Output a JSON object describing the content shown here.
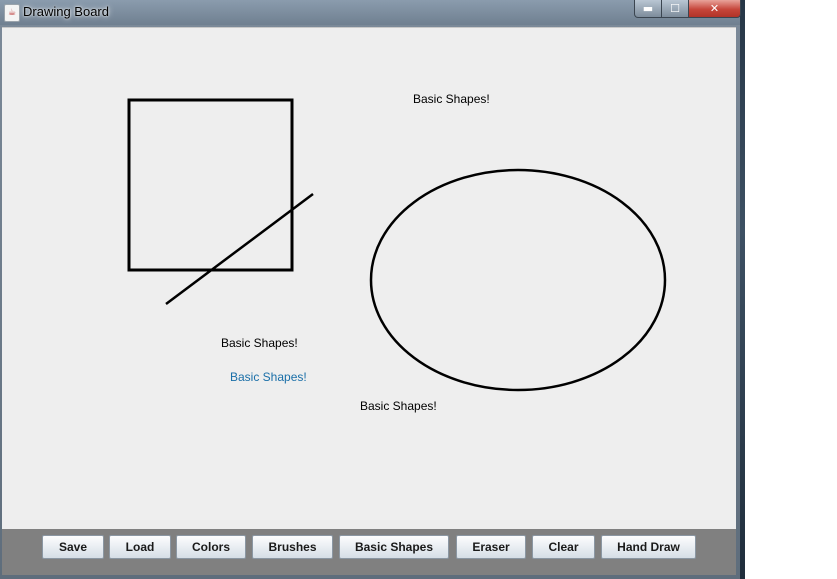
{
  "window": {
    "title": "Drawing Board",
    "icon": "java-cup-icon",
    "controls": {
      "minimize_glyph": "▬",
      "maximize_glyph": "☐",
      "close_glyph": "✕"
    }
  },
  "canvas": {
    "background": "#eeeeee",
    "stroke_color": "#000000",
    "texts": [
      {
        "text": "Basic Shapes!",
        "color": "#000000"
      },
      {
        "text": "Basic Shapes!",
        "color": "#000000"
      },
      {
        "text": "Basic Shapes!",
        "color": "#1a6fa8"
      },
      {
        "text": "Basic Shapes!",
        "color": "#000000"
      }
    ]
  },
  "toolbar": {
    "background": "#808080",
    "buttons": [
      {
        "label": "Save"
      },
      {
        "label": "Load"
      },
      {
        "label": "Colors"
      },
      {
        "label": "Brushes"
      },
      {
        "label": "Basic Shapes"
      },
      {
        "label": "Eraser"
      },
      {
        "label": "Clear"
      },
      {
        "label": "Hand Draw"
      }
    ]
  }
}
